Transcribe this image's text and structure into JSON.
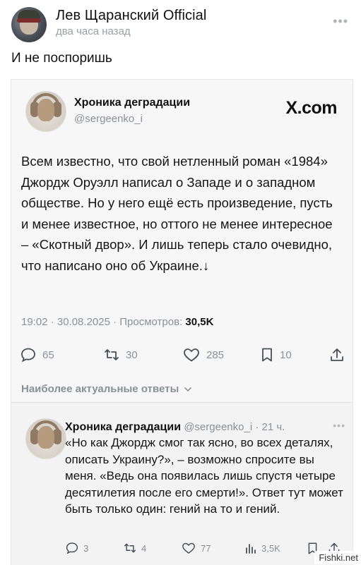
{
  "post": {
    "author": "Лев Щаранский Official",
    "time": "два часа назад",
    "more": "•••",
    "text": "И не поспоришь"
  },
  "embed": {
    "tweet": {
      "name": "Хроника деградации",
      "handle": "@sergeenko_i",
      "brand": "X.com",
      "body": "Всем известно, что свой нетленный роман «1984» Джордж Оруэлл написал о Западе и о западном обществе. Но у него ещё есть произведение, пусть и менее известное, но оттого не менее интересное – «Скотный двор». И лишь теперь стало очевидно, что написано оно об Украине.↓",
      "meta_prefix": "19:02 · 30.08.2025 · Просмотров: ",
      "views": "30,5K",
      "actions": {
        "replies": "65",
        "retweets": "30",
        "likes": "285",
        "bookmarks": "10"
      }
    },
    "relevant_label": "Наиболее актуальные ответы",
    "reply": {
      "name": "Хроника деградации",
      "handle_time": "@sergeenko_i · 21 ч.",
      "more": "•••",
      "body": "«Но как Джордж смог так ясно, во всех деталях, описать Украину?», – возможно спросите вы меня. «Ведь она появилась лишь спустя четыре десятилетия после его смерти!». Ответ тут может быть только один: гений на то и гений.",
      "actions": {
        "replies": "3",
        "retweets": "4",
        "likes": "77",
        "views": "3,5K"
      }
    }
  },
  "watermark": "Fishki.net",
  "icons": {
    "reply": "reply-icon",
    "retweet": "retweet-icon",
    "like": "heart-icon",
    "bookmark": "bookmark-icon",
    "share": "share-icon",
    "views": "bar-chart-icon"
  }
}
